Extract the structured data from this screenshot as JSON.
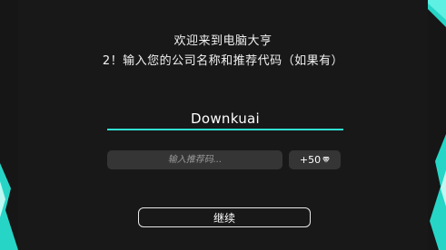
{
  "welcome": {
    "title": "欢迎来到电脑大亨",
    "prompt": "2！输入您的公司名称和推荐代码（如果有）"
  },
  "form": {
    "company_name_value": "Downkuai",
    "referral_placeholder": "输入推荐码...",
    "bonus_label": "+50",
    "bonus_icon": "gem-icon"
  },
  "actions": {
    "continue_label": "继续"
  },
  "colors": {
    "background": "#181818",
    "accent": "#2fe0d2",
    "field_background": "#353535"
  }
}
